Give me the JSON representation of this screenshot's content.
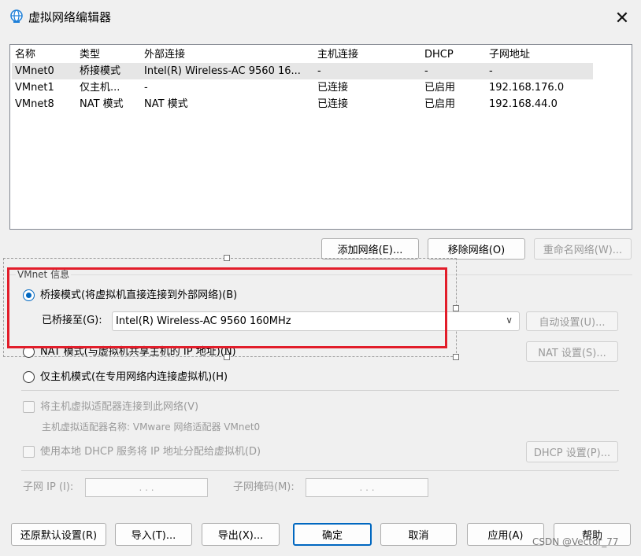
{
  "window": {
    "title": "虚拟网络编辑器",
    "close_label": "✕"
  },
  "table": {
    "headers": [
      "名称",
      "类型",
      "外部连接",
      "主机连接",
      "DHCP",
      "子网地址"
    ],
    "rows": [
      [
        "VMnet0",
        "桥接模式",
        "Intel(R) Wireless-AC 9560 16...",
        "-",
        "-",
        "-"
      ],
      [
        "VMnet1",
        "仅主机...",
        "-",
        "已连接",
        "已启用",
        "192.168.176.0"
      ],
      [
        "VMnet8",
        "NAT 模式",
        "NAT 模式",
        "已连接",
        "已启用",
        "192.168.44.0"
      ]
    ],
    "selected_row": 0
  },
  "list_buttons": {
    "add": "添加网络(E)...",
    "remove": "移除网络(O)",
    "rename": "重命名网络(W)..."
  },
  "info": {
    "group_label": "VMnet 信息",
    "bridged_label": "桥接模式(将虚拟机直接连接到外部网络)(B)",
    "bridged_to_label": "已桥接至(G):",
    "bridged_to_value": "Intel(R) Wireless-AC 9560 160MHz",
    "auto_settings": "自动设置(U)...",
    "nat_label": "NAT 模式(与虚拟机共享主机的 IP 地址)(N)",
    "nat_settings": "NAT 设置(S)...",
    "hostonly_label": "仅主机模式(在专用网络内连接虚拟机)(H)",
    "connect_adapter_label": "将主机虚拟适配器连接到此网络(V)",
    "adapter_name_label": "主机虚拟适配器名称: VMware 网络适配器 VMnet0",
    "dhcp_label": "使用本地 DHCP 服务将 IP 地址分配给虚拟机(D)",
    "dhcp_settings": "DHCP 设置(P)...",
    "subnet_ip_label": "子网 IP (I):",
    "subnet_mask_label": "子网掩码(M):",
    "ip_dots": ". . .",
    "mask_dots": ". . ."
  },
  "footer": {
    "restore": "还原默认设置(R)",
    "import": "导入(T)...",
    "export": "导出(X)...",
    "ok": "确定",
    "cancel": "取消",
    "apply": "应用(A)",
    "help": "帮助"
  },
  "watermark": "CSDN @Vector_77",
  "colors": {
    "accent": "#0067c0",
    "highlight_box": "#e21d2a",
    "selected_row": "#e6e6e6"
  }
}
